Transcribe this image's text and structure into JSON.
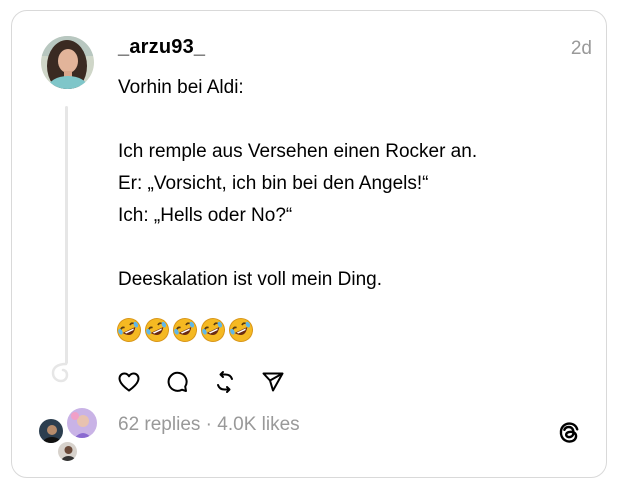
{
  "post": {
    "username": "_arzu93_",
    "timestamp": "2d",
    "lines": [
      "Vorhin bei Aldi:",
      "",
      "Ich remple aus Versehen einen Rocker an.",
      "Er: „Vorsicht, ich bin bei den Angels!“",
      "Ich: „Hells oder No?“",
      "",
      "Deeskalation ist voll mein Ding."
    ],
    "emojis": [
      "🤣",
      "🤣",
      "🤣",
      "🤣",
      "🤣"
    ]
  },
  "stats": {
    "replies": "62 replies",
    "separator": " · ",
    "likes": "4.0K likes"
  },
  "icons": {
    "like": "heart-icon",
    "reply": "comment-icon",
    "repost": "repost-icon",
    "share": "send-icon",
    "brand": "threads-logo-icon"
  },
  "colors": {
    "muted": "#999999",
    "border": "#d9d9d9",
    "text": "#000000"
  }
}
